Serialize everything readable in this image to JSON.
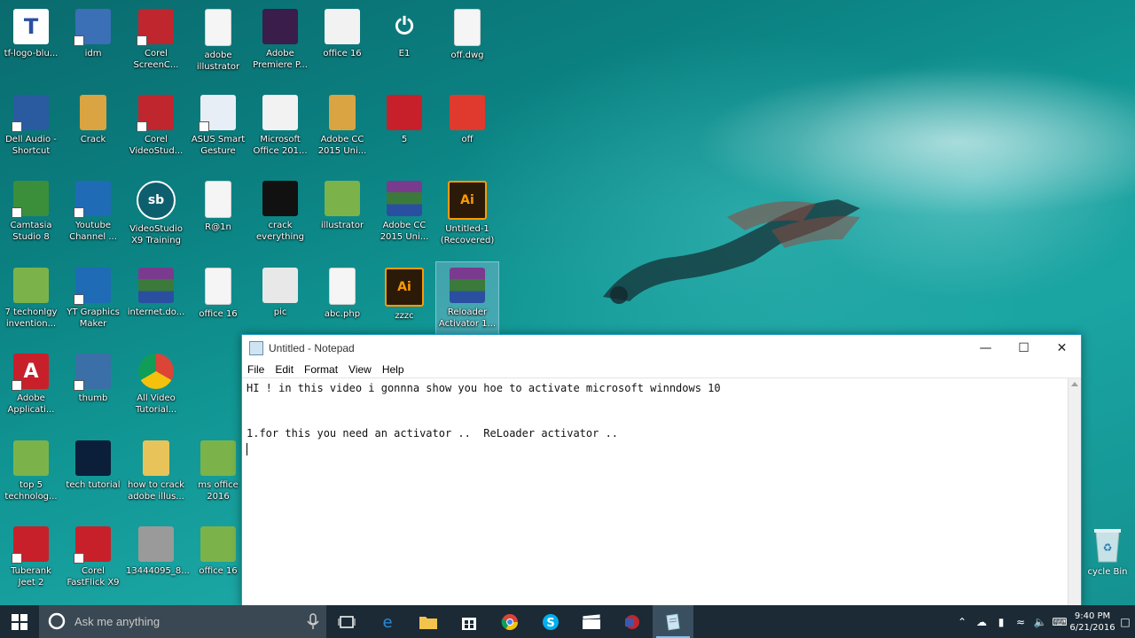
{
  "desktop_icons": [
    {
      "label": "tf-logo-blu...",
      "kind": "tf-logo",
      "color": "#2a4fa0"
    },
    {
      "label": "idm",
      "kind": "idm",
      "color": "#3b6fb6"
    },
    {
      "label": "Corel\nScreenC...",
      "kind": "corel-screencap",
      "color": "#c0262d"
    },
    {
      "label": "adobe\nillustrator",
      "kind": "document",
      "color": "#f5f5f5"
    },
    {
      "label": "Adobe\nPremiere P...",
      "kind": "premiere",
      "color": "#3a1d4a"
    },
    {
      "label": "office 16",
      "kind": "office",
      "color": "#f2f2f2"
    },
    {
      "label": "E1",
      "kind": "power",
      "color": "#111111"
    },
    {
      "label": "off.dwg",
      "kind": "document",
      "color": "#f5f5f5"
    },
    {
      "label": "Dell Audio -\nShortcut",
      "kind": "dell-audio",
      "color": "#2a5ba0"
    },
    {
      "label": "Crack",
      "kind": "folder-red",
      "color": "#d9a441"
    },
    {
      "label": "Corel\nVideoStud...",
      "kind": "corel-video",
      "color": "#c0262d"
    },
    {
      "label": "ASUS Smart\nGesture",
      "kind": "asus",
      "color": "#e8eef5"
    },
    {
      "label": "Microsoft\nOffice 201...",
      "kind": "office",
      "color": "#f2f2f2"
    },
    {
      "label": "Adobe CC\n2015 Uni...",
      "kind": "folder-red",
      "color": "#d9a441"
    },
    {
      "label": "5",
      "kind": "ccleaner",
      "color": "#c8202a"
    },
    {
      "label": "off",
      "kind": "office-red",
      "color": "#e03a2e"
    },
    {
      "label": "Camtasia\nStudio 8",
      "kind": "camtasia",
      "color": "#3b8f3b"
    },
    {
      "label": "Youtube\nChannel ...",
      "kind": "parrot",
      "color": "#1f6bb5"
    },
    {
      "label": "VideoStudio\nX9 Training",
      "kind": "sb",
      "color": "#0e5f6e"
    },
    {
      "label": "R@1n",
      "kind": "document",
      "color": "#f5f5f5"
    },
    {
      "label": "crack\neverything",
      "kind": "video-black",
      "color": "#111111"
    },
    {
      "label": "illustrator",
      "kind": "video-green",
      "color": "#7bb34a"
    },
    {
      "label": "Adobe CC\n2015 Uni...",
      "kind": "winrar",
      "color": "#7a3b8f"
    },
    {
      "label": "Untitled-1\n(Recovered)",
      "kind": "ai",
      "color": "#2b1a08"
    },
    {
      "label": "7 techonlgy\ninvention...",
      "kind": "video-green",
      "color": "#7bb34a"
    },
    {
      "label": "YT Graphics\nMaker",
      "kind": "parrot",
      "color": "#1f6bb5"
    },
    {
      "label": "internet.do...",
      "kind": "winrar",
      "color": "#7a3b8f"
    },
    {
      "label": "office 16",
      "kind": "document",
      "color": "#f5f5f5"
    },
    {
      "label": "pic",
      "kind": "pic",
      "color": "#e8e8e8"
    },
    {
      "label": "abc.php",
      "kind": "document",
      "color": "#f5f5f5"
    },
    {
      "label": "zzzc",
      "kind": "ai",
      "color": "#2b1a08"
    },
    {
      "label": "Reloader\nActivator 1...",
      "kind": "winrar",
      "color": "#7a3b8f"
    },
    {
      "label": "Adobe\nApplicati...",
      "kind": "adobe",
      "color": "#c8202a"
    },
    {
      "label": "thumb",
      "kind": "thumb",
      "color": "#3a6fa8"
    },
    {
      "label": "All Video\nTutorial...",
      "kind": "chrome",
      "color": "#ffffff"
    },
    {
      "label": "top 5\ntechnolog...",
      "kind": "video-green",
      "color": "#7bb34a"
    },
    {
      "label": "tech tutorial",
      "kind": "tech",
      "color": "#0c1f3a"
    },
    {
      "label": "how to crack\nadobe illus...",
      "kind": "folder",
      "color": "#e8c35a"
    },
    {
      "label": "ms office\n2016",
      "kind": "video-green",
      "color": "#7bb34a"
    },
    {
      "label": "Tuberank\nJeet 2",
      "kind": "tuberank",
      "color": "#c8202a"
    },
    {
      "label": "Corel\nFastFlick X9",
      "kind": "fastflick",
      "color": "#c8202a"
    },
    {
      "label": "13444095_8...",
      "kind": "photo",
      "color": "#9a9a9a"
    },
    {
      "label": "office 16",
      "kind": "video-green",
      "color": "#7bb34a"
    }
  ],
  "recycle_bin": {
    "label": "cycle Bin"
  },
  "notepad": {
    "title": "Untitled - Notepad",
    "menu": [
      "File",
      "Edit",
      "Format",
      "View",
      "Help"
    ],
    "lines": [
      "HI ! in this video i gonnna show you hoe to activate microsoft winndows 10",
      "",
      "",
      "1.for this you need an activator ..  ReLoader activator ..",
      ""
    ]
  },
  "taskbar": {
    "search_placeholder": "Ask me anything",
    "clock_time": "9:40 PM",
    "clock_date": "6/21/2016",
    "pinned": [
      "task-view",
      "edge",
      "file-explorer",
      "store",
      "chrome",
      "skype",
      "video-editor",
      "corel",
      "notepad"
    ]
  },
  "colors": {
    "taskbar": "#1b2a35",
    "notepad_border": "#1e9ec8",
    "accent": "#7fc4ee"
  }
}
